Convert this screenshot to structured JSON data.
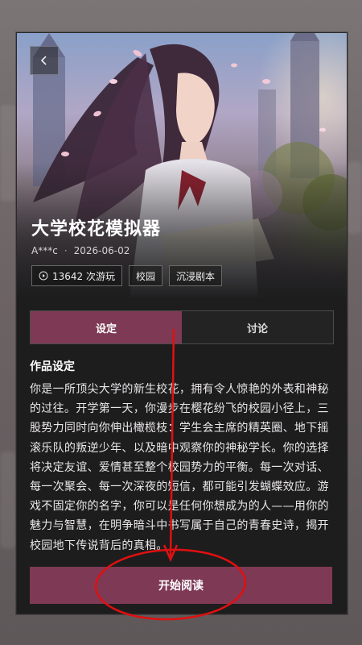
{
  "story": {
    "title": "大学校花模拟器",
    "author": "A***c",
    "separator": "·",
    "date": "2026-06-02"
  },
  "stats": {
    "plays_label": "13642 次游玩"
  },
  "tags": [
    "校园",
    "沉浸剧本"
  ],
  "tabs": [
    {
      "label": "设定",
      "active": true
    },
    {
      "label": "讨论",
      "active": false
    }
  ],
  "section": {
    "title": "作品设定",
    "description": "你是一所顶尖大学的新生校花，拥有令人惊艳的外表和神秘的过往。开学第一天，你漫步在樱花纷飞的校园小径上，三股势力同时向你伸出橄榄枝：学生会主席的精英圈、地下摇滚乐队的叛逆少年、以及暗中观察你的神秘学长。你的选择将决定友谊、爱情甚至整个校园势力的平衡。每一次对话、每一次聚会、每一次深夜的短信，都可能引发蝴蝶效应。游戏不固定你的名字，你可以是任何你想成为的人——用你的魅力与智慧，在明争暗斗中书写属于自己的青春史诗，揭开校园地下传说背后的真相。"
  },
  "actions": {
    "start_label": "开始阅读"
  },
  "colors": {
    "accent": "#7e3a55",
    "annotation": "#e01010",
    "card_bg": "#1d1d1e"
  },
  "icons": {
    "back": "chevron-left-icon",
    "plays": "play-circle-icon"
  }
}
